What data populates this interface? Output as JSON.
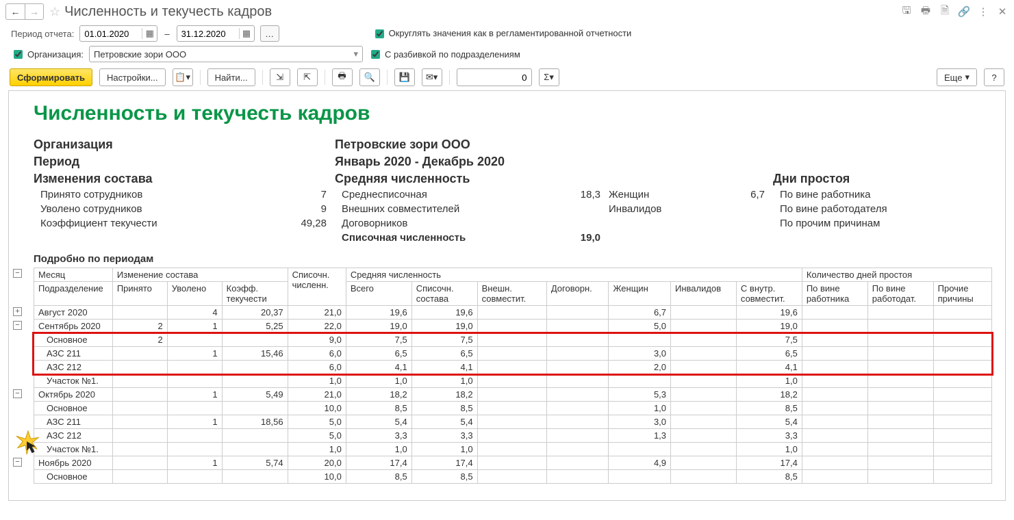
{
  "title": "Численность и текучесть кадров",
  "period_label": "Период отчета:",
  "date_from": "01.01.2020",
  "date_to": "31.12.2020",
  "round_checkbox": "Округлять значения как в регламентированной отчетности",
  "org_checkbox_label": "Организация:",
  "org_value": "Петровские зори ООО",
  "subdiv_checkbox": "С разбивкой по подразделениям",
  "toolbar": {
    "form": "Сформировать",
    "settings": "Настройки...",
    "find": "Найти...",
    "num_value": "0",
    "more": "Еще",
    "help": "?"
  },
  "report": {
    "title": "Численность и текучесть кадров",
    "org_label": "Организация",
    "org_value": "Петровские зори ООО",
    "period_label": "Период",
    "period_value": "Январь 2020 - Декабрь 2020",
    "sec_changes": "Изменения состава",
    "hired_label": "Принято сотрудников",
    "hired_value": "7",
    "fired_label": "Уволено сотрудников",
    "fired_value": "9",
    "coef_label": "Коэффициент текучести",
    "coef_value": "49,28",
    "sec_avg": "Средняя численность",
    "avg_list_label": "Среднесписочная",
    "avg_list_value": "18,3",
    "ext_label": "Внешних совместителей",
    "contr_label": "Договорников",
    "list_count_label": "Списочная численность",
    "list_count_value": "19,0",
    "women_label": "Женщин",
    "women_value": "6,7",
    "invalid_label": "Инвалидов",
    "sec_idle": "Дни простоя",
    "idle_emp": "По вине работника",
    "idle_empr": "По вине работодателя",
    "idle_other": "По прочим причинам",
    "periods_label": "Подробно по периодам"
  },
  "table": {
    "headers": {
      "month": "Месяц",
      "subdiv": "Подразделение",
      "changes_group": "Изменение состава",
      "hired": "Принято",
      "fired": "Уволено",
      "coef": "Коэфф. текучести",
      "list": "Списочн. численн.",
      "avg_group": "Средняя численность",
      "total": "Всего",
      "list_count": "Списочн. состава",
      "ext": "Внешн. совместит.",
      "contr": "Договорн.",
      "women": "Женщин",
      "invalid": "Инвалидов",
      "intern": "С внутр. совместит.",
      "idle_group": "Количество дней простоя",
      "idle_emp": "По вине работника",
      "idle_empr": "По вине работодат.",
      "idle_other": "Прочие причины"
    },
    "rows": [
      {
        "label": "Август 2020",
        "hired": "",
        "fired": "4",
        "coef": "20,37",
        "list": "21,0",
        "total": "19,6",
        "listc": "19,6",
        "ext": "",
        "contr": "",
        "women": "6,7",
        "inv": "",
        "intern": "19,6",
        "sub": false,
        "toggle": "+"
      },
      {
        "label": "Сентябрь 2020",
        "hired": "2",
        "fired": "1",
        "coef": "5,25",
        "list": "22,0",
        "total": "19,0",
        "listc": "19,0",
        "ext": "",
        "contr": "",
        "women": "5,0",
        "inv": "",
        "intern": "19,0",
        "sub": false,
        "toggle": "−"
      },
      {
        "label": "Основное",
        "hired": "2",
        "fired": "",
        "coef": "",
        "list": "9,0",
        "total": "7,5",
        "listc": "7,5",
        "ext": "",
        "contr": "",
        "women": "",
        "inv": "",
        "intern": "7,5",
        "sub": true,
        "hl": true
      },
      {
        "label": "АЗС 211",
        "hired": "",
        "fired": "1",
        "coef": "15,46",
        "list": "6,0",
        "total": "6,5",
        "listc": "6,5",
        "ext": "",
        "contr": "",
        "women": "3,0",
        "inv": "",
        "intern": "6,5",
        "sub": true,
        "hl": true
      },
      {
        "label": "АЗС 212",
        "hired": "",
        "fired": "",
        "coef": "",
        "list": "6,0",
        "total": "4,1",
        "listc": "4,1",
        "ext": "",
        "contr": "",
        "women": "2,0",
        "inv": "",
        "intern": "4,1",
        "sub": true,
        "hl": true
      },
      {
        "label": "Участок №1.",
        "hired": "",
        "fired": "",
        "coef": "",
        "list": "1,0",
        "total": "1,0",
        "listc": "1,0",
        "ext": "",
        "contr": "",
        "women": "",
        "inv": "",
        "intern": "1,0",
        "sub": true
      },
      {
        "label": "Октябрь 2020",
        "hired": "",
        "fired": "1",
        "coef": "5,49",
        "list": "21,0",
        "total": "18,2",
        "listc": "18,2",
        "ext": "",
        "contr": "",
        "women": "5,3",
        "inv": "",
        "intern": "18,2",
        "sub": false,
        "toggle": "−"
      },
      {
        "label": "Основное",
        "hired": "",
        "fired": "",
        "coef": "",
        "list": "10,0",
        "total": "8,5",
        "listc": "8,5",
        "ext": "",
        "contr": "",
        "women": "1,0",
        "inv": "",
        "intern": "8,5",
        "sub": true
      },
      {
        "label": "АЗС 211",
        "hired": "",
        "fired": "1",
        "coef": "18,56",
        "list": "5,0",
        "total": "5,4",
        "listc": "5,4",
        "ext": "",
        "contr": "",
        "women": "3,0",
        "inv": "",
        "intern": "5,4",
        "sub": true
      },
      {
        "label": "АЗС 212",
        "hired": "",
        "fired": "",
        "coef": "",
        "list": "5,0",
        "total": "3,3",
        "listc": "3,3",
        "ext": "",
        "contr": "",
        "women": "1,3",
        "inv": "",
        "intern": "3,3",
        "sub": true
      },
      {
        "label": "Участок №1.",
        "hired": "",
        "fired": "",
        "coef": "",
        "list": "1,0",
        "total": "1,0",
        "listc": "1,0",
        "ext": "",
        "contr": "",
        "women": "",
        "inv": "",
        "intern": "1,0",
        "sub": true
      },
      {
        "label": "Ноябрь 2020",
        "hired": "",
        "fired": "1",
        "coef": "5,74",
        "list": "20,0",
        "total": "17,4",
        "listc": "17,4",
        "ext": "",
        "contr": "",
        "women": "4,9",
        "inv": "",
        "intern": "17,4",
        "sub": false,
        "toggle": "−"
      },
      {
        "label": "Основное",
        "hired": "",
        "fired": "",
        "coef": "",
        "list": "10,0",
        "total": "8,5",
        "listc": "8,5",
        "ext": "",
        "contr": "",
        "women": "",
        "inv": "",
        "intern": "8,5",
        "sub": true
      }
    ]
  }
}
